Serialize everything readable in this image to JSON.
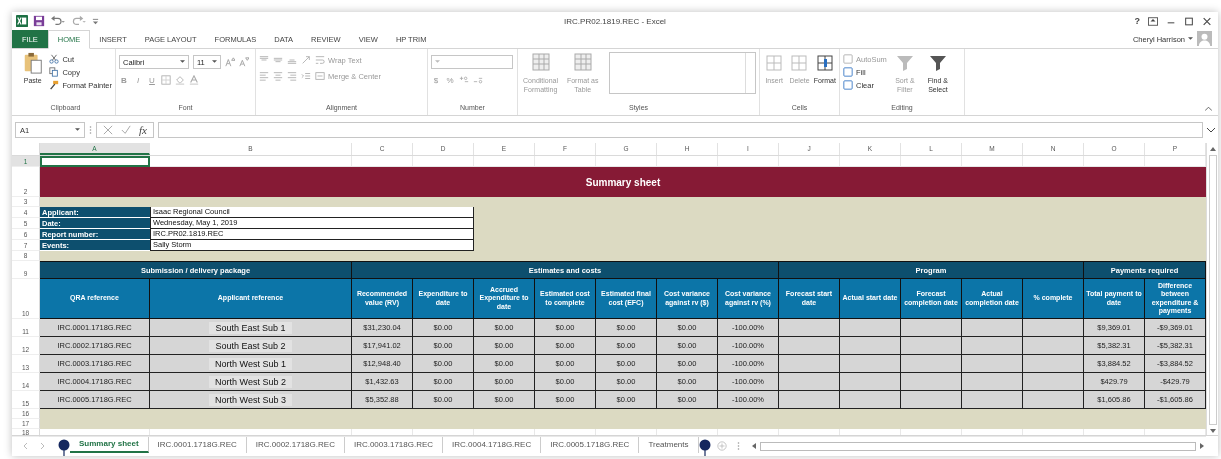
{
  "window": {
    "title": "IRC.PR02.1819.REC - Excel",
    "help": "?",
    "user": "Cheryl Harrison"
  },
  "ribbon_tabs": [
    {
      "label": "FILE",
      "kind": "file",
      "selected": false
    },
    {
      "label": "HOME",
      "kind": "tab",
      "selected": true
    },
    {
      "label": "INSERT",
      "kind": "tab",
      "selected": false
    },
    {
      "label": "PAGE LAYOUT",
      "kind": "tab",
      "selected": false
    },
    {
      "label": "FORMULAS",
      "kind": "tab",
      "selected": false
    },
    {
      "label": "DATA",
      "kind": "tab",
      "selected": false
    },
    {
      "label": "REVIEW",
      "kind": "tab",
      "selected": false
    },
    {
      "label": "VIEW",
      "kind": "tab",
      "selected": false
    },
    {
      "label": "HP TRIM",
      "kind": "tab",
      "selected": false
    }
  ],
  "ribbon": {
    "clipboard": {
      "label": "Clipboard",
      "paste": "Paste",
      "cut": "Cut",
      "copy": "Copy",
      "format_painter": "Format Painter"
    },
    "font": {
      "label": "Font",
      "font_name": "Calibri",
      "font_size": "11",
      "styles": [
        "B",
        "I",
        "U"
      ]
    },
    "alignment": {
      "label": "Alignment",
      "wrap_text": "Wrap Text",
      "merge": "Merge & Center"
    },
    "number": {
      "label": "Number",
      "symbols": [
        "$",
        "%"
      ]
    },
    "styles": {
      "label": "Styles",
      "buttons": [
        {
          "label": "Conditional Formatting"
        },
        {
          "label": "Format as Table"
        }
      ]
    },
    "cells": {
      "label": "Cells",
      "buttons": [
        {
          "label": "Insert",
          "disabled": true
        },
        {
          "label": "Delete",
          "disabled": true
        },
        {
          "label": "Format",
          "disabled": false
        }
      ]
    },
    "editing": {
      "label": "Editing",
      "small": [
        {
          "label": "AutoSum",
          "disabled": true
        },
        {
          "label": "Fill",
          "disabled": false
        },
        {
          "label": "Clear",
          "disabled": false
        }
      ],
      "buttons": [
        {
          "label": "Sort & Filter",
          "disabled": true
        },
        {
          "label": "Find & Select",
          "disabled": false
        }
      ]
    }
  },
  "formula_bar": {
    "name_box": "A1",
    "function_label": "fx"
  },
  "sheet": {
    "column_letters": [
      "A",
      "B",
      "C",
      "D",
      "E",
      "F",
      "G",
      "H",
      "I",
      "J",
      "K",
      "L",
      "M",
      "N",
      "O",
      "P"
    ],
    "row_numbers": [
      "1",
      "2",
      "3",
      "4",
      "5",
      "6",
      "7",
      "8",
      "9",
      "10",
      "11",
      "12",
      "13",
      "14",
      "15",
      "16",
      "17",
      "18"
    ],
    "title": "Summary sheet",
    "info": [
      {
        "label": "Applicant:",
        "value": "Isaac Regional Council"
      },
      {
        "label": "Date:",
        "value": "Wednesday, May 1, 2019"
      },
      {
        "label": "Report number:",
        "value": "IRC.PR02.1819.REC"
      },
      {
        "label": "Events:",
        "value": "Sally Storm"
      }
    ],
    "groups": [
      {
        "label": "Submission / delivery package",
        "columns": [
          "QRA reference",
          "Applicant reference"
        ]
      },
      {
        "label": "Estimates and costs",
        "columns": [
          "Recommended value (RV)",
          "Expenditure to date",
          "Accrued Expenditure to date",
          "Estimated cost to complete",
          "Estimated final cost (EFC)",
          "Cost variance against rv ($)",
          "Cost variance against rv (%)"
        ]
      },
      {
        "label": "Program",
        "columns": [
          "Forecast start date",
          "Actual start date",
          "Forecast completion date",
          "Actual completion date",
          "% complete"
        ]
      },
      {
        "label": "Payments required",
        "columns": [
          "Total payment to date",
          "Difference between expenditure & payments"
        ]
      }
    ],
    "rows": [
      {
        "cells": [
          "IRC.0001.1718G.REC",
          "South East Sub 1",
          "$31,230.04",
          "$0.00",
          "$0.00",
          "$0.00",
          "$0.00",
          "$0.00",
          "-100.00%",
          null,
          null,
          null,
          null,
          null,
          "$9,369.01",
          "-$9,369.01"
        ]
      },
      {
        "cells": [
          "IRC.0002.1718G.REC",
          "South East Sub 2",
          "$17,941.02",
          "$0.00",
          "$0.00",
          "$0.00",
          "$0.00",
          "$0.00",
          "-100.00%",
          null,
          null,
          null,
          null,
          null,
          "$5,382.31",
          "-$5,382.31"
        ]
      },
      {
        "cells": [
          "IRC.0003.1718G.REC",
          "North West Sub 1",
          "$12,948.40",
          "$0.00",
          "$0.00",
          "$0.00",
          "$0.00",
          "$0.00",
          "-100.00%",
          null,
          null,
          null,
          null,
          null,
          "$3,884.52",
          "-$3,884.52"
        ]
      },
      {
        "cells": [
          "IRC.0004.1718G.REC",
          "North West Sub 2",
          "$1,432.63",
          "$0.00",
          "$0.00",
          "$0.00",
          "$0.00",
          "$0.00",
          "-100.00%",
          null,
          null,
          null,
          null,
          null,
          "$429.79",
          "-$429.79"
        ]
      },
      {
        "cells": [
          "IRC.0005.1718G.REC",
          "North West Sub 3",
          "$5,352.88",
          "$0.00",
          "$0.00",
          "$0.00",
          "$0.00",
          "$0.00",
          "-100.00%",
          null,
          null,
          null,
          null,
          null,
          "$1,605.86",
          "-$1,605.86"
        ]
      }
    ]
  },
  "sheet_tabs": [
    {
      "label": "Summary sheet",
      "selected": true
    },
    {
      "label": "IRC.0001.1718G.REC",
      "selected": false
    },
    {
      "label": "IRC.0002.1718G.REC",
      "selected": false
    },
    {
      "label": "IRC.0003.1718G.REC",
      "selected": false
    },
    {
      "label": "IRC.0004.1718G.REC",
      "selected": false
    },
    {
      "label": "IRC.0005.1718G.REC",
      "selected": false
    },
    {
      "label": "Treatments",
      "selected": false
    }
  ]
}
